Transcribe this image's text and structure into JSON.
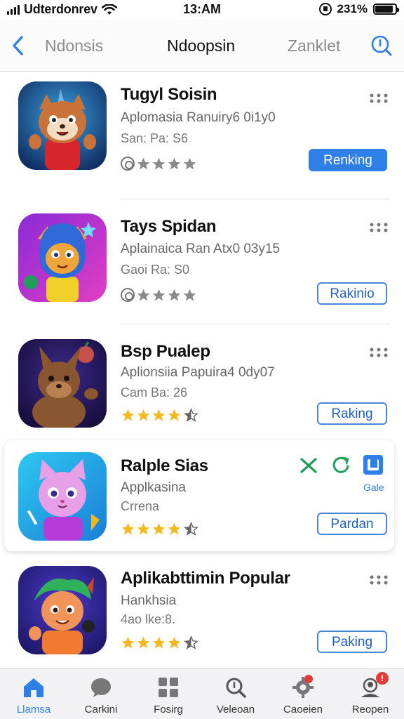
{
  "status_bar": {
    "carrier": "Udterdonrev",
    "time": "13:AM",
    "battery_pct": "231%",
    "battery_level": 0.9
  },
  "nav": {
    "back_icon": "chevron-left-icon",
    "left_label": "Ndonsis",
    "title": "Ndoopsin",
    "right_label": "Zanklet",
    "search_icon": "search-icon"
  },
  "apps": [
    {
      "name": "Tugyl Soisin",
      "subtitle": "Aplomasia Ranuiry6 0i1y0",
      "meta": "San: Pa: S6",
      "rating_label": "",
      "button": "Renking",
      "button_style": "primary"
    },
    {
      "name": "Tays Spidan",
      "subtitle": "Aplainaica Ran Atx0 03y15",
      "meta": "Gaoi Ra: S0",
      "button": "Rakinio",
      "button_style": "outline"
    },
    {
      "name": "Bsp Pualep",
      "subtitle": "Aplionsiia Papuira4 0dy07",
      "meta": "Cam Ba: 26",
      "button": "Raking",
      "button_style": "outline"
    },
    {
      "name": "Ralple Sias",
      "subtitle": "Applkasina",
      "meta": "Crrena",
      "button": "Pardan",
      "button_style": "outline",
      "action_label": "Gale"
    },
    {
      "name": "Aplikabttimin Popular",
      "subtitle": "Hankhsia",
      "meta": "4ao lke:8.",
      "button": "Paking",
      "button_style": "outline"
    }
  ],
  "tabs": [
    {
      "label": "Llamsa",
      "icon": "home-icon",
      "active": true
    },
    {
      "label": "Carkini",
      "icon": "chat-icon",
      "active": false
    },
    {
      "label": "Fosirg",
      "icon": "grid-icon",
      "active": false
    },
    {
      "label": "Veleoan",
      "icon": "search-icon",
      "active": false
    },
    {
      "label": "Caoeien",
      "icon": "gear-icon",
      "active": false,
      "badge": ""
    },
    {
      "label": "Reopen",
      "icon": "profile-icon",
      "active": false,
      "badge": "!"
    }
  ],
  "colors": {
    "accent": "#2f7fe8",
    "star_gold": "#f5b81f",
    "star_gray": "#8a8a8a",
    "badge_red": "#e23b3b"
  }
}
